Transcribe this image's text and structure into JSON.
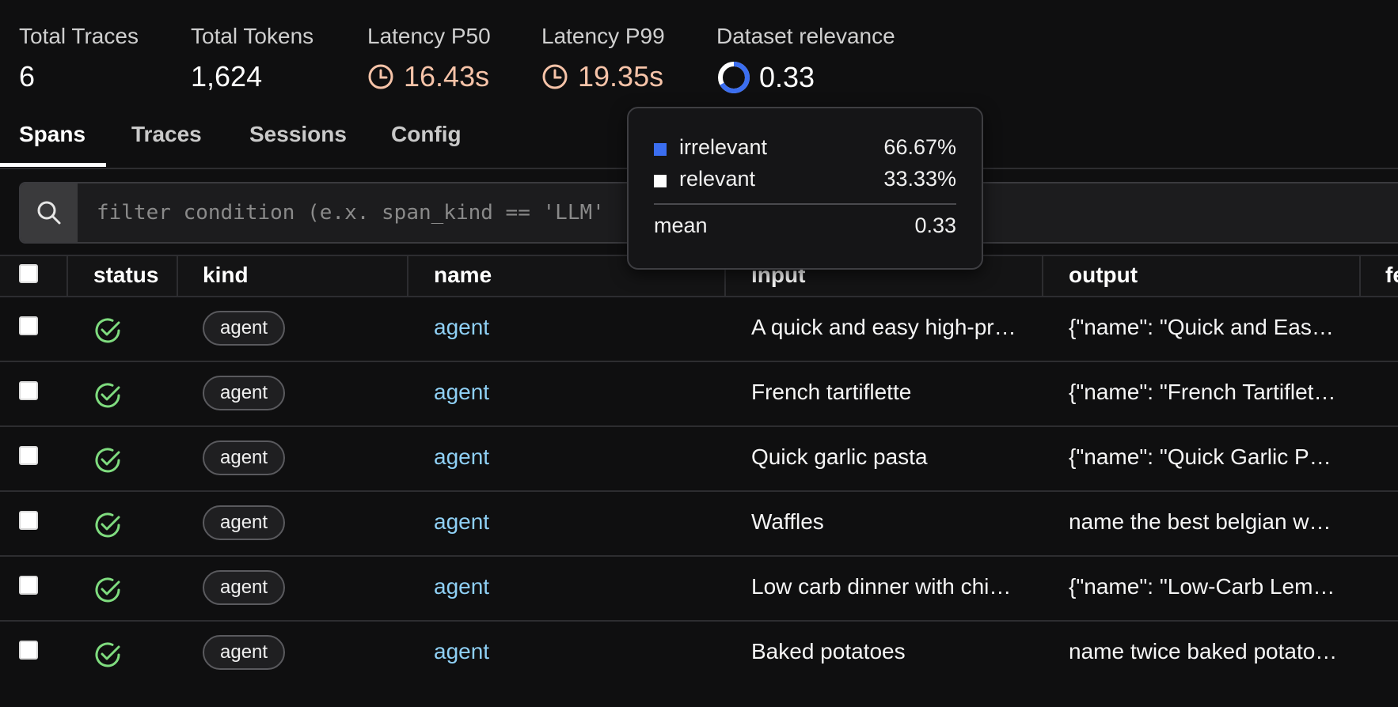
{
  "colors": {
    "background": "#0f0f10",
    "latency_accent": "#f6c3a8",
    "link": "#8fd0f5",
    "success": "#7fdc7f",
    "irrelevant": "#3b6ef0",
    "relevant": "#ffffff"
  },
  "stats": {
    "total_traces": {
      "label": "Total Traces",
      "value": "6"
    },
    "total_tokens": {
      "label": "Total Tokens",
      "value": "1,624"
    },
    "latency_p50": {
      "label": "Latency P50",
      "value": "16.43s",
      "icon": "clock-icon"
    },
    "latency_p99": {
      "label": "Latency P99",
      "value": "19.35s",
      "icon": "clock-icon"
    },
    "dataset_relevance": {
      "label": "Dataset relevance",
      "value": "0.33",
      "icon": "donut-chart-icon",
      "fraction": 0.33
    }
  },
  "tabs": [
    {
      "label": "Spans",
      "active": true
    },
    {
      "label": "Traces",
      "active": false
    },
    {
      "label": "Sessions",
      "active": false
    },
    {
      "label": "Config",
      "active": false
    }
  ],
  "search": {
    "icon": "search-icon",
    "placeholder": "filter condition (e.x. span_kind == 'LLM'"
  },
  "table": {
    "columns": [
      "status",
      "kind",
      "name",
      "input",
      "output",
      "fe"
    ],
    "rows": [
      {
        "status": "ok",
        "kind": "agent",
        "name": "agent",
        "input": "A quick and easy high-pr…",
        "output": "{\"name\": \"Quick and Easy …"
      },
      {
        "status": "ok",
        "kind": "agent",
        "name": "agent",
        "input": "French tartiflette",
        "output": "{\"name\": \"French Tartiflett…"
      },
      {
        "status": "ok",
        "kind": "agent",
        "name": "agent",
        "input": "Quick garlic pasta",
        "output": "{\"name\": \"Quick Garlic Pa…"
      },
      {
        "status": "ok",
        "kind": "agent",
        "name": "agent",
        "input": "Waffles",
        "output": "name the best belgian wa…"
      },
      {
        "status": "ok",
        "kind": "agent",
        "name": "agent",
        "input": "Low carb dinner with chic…",
        "output": "{\"name\": \"Low-Carb Lemo…"
      },
      {
        "status": "ok",
        "kind": "agent",
        "name": "agent",
        "input": "Baked potatoes",
        "output": "name twice baked potato…"
      }
    ]
  },
  "tooltip": {
    "items": [
      {
        "label": "irrelevant",
        "value": "66.67%"
      },
      {
        "label": "relevant",
        "value": "33.33%"
      }
    ],
    "mean_label": "mean",
    "mean_value": "0.33"
  }
}
